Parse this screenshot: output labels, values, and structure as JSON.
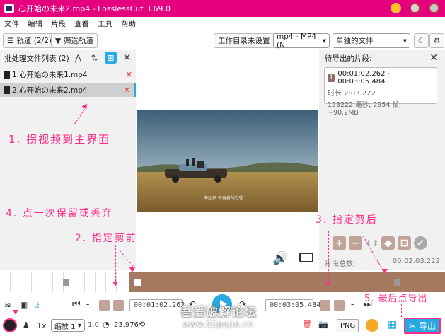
{
  "window": {
    "title": "心开始の未来2.mp4 - LosslessCut 3.69.0"
  },
  "menu": [
    "文件",
    "编辑",
    "片段",
    "查看",
    "工具",
    "帮助"
  ],
  "toolbar": {
    "tracks": "轨道 (2/2)",
    "filter_tracks": "筛选轨道",
    "workdir": "工作目录未设置",
    "format": "mp4 - MP4 (N",
    "output_mode": "单独的文件"
  },
  "file_list": {
    "header": "批处理文件列表 (2)",
    "files": [
      {
        "name": "1.心开始の未来1.mp4"
      },
      {
        "name": "2.心开始の未来2.mp4"
      }
    ]
  },
  "video": {
    "subtitle": "申起杯 每吉春的过往"
  },
  "segments": {
    "header": "待导出的片段:",
    "items": [
      {
        "num": "1",
        "range": "00:01:02.262 - 00:03:05.484",
        "duration": "时长 2:03.222",
        "info": "123222 毫秒, 2954 帧, ~90.2MB"
      }
    ],
    "total_label": "片段总数:",
    "total_time": "00:02:03.222"
  },
  "controls": {
    "start_time": "00:01:02.262",
    "end_time": "00:03:05.484"
  },
  "bottom": {
    "speed": "1x",
    "zoom": "缩放 1",
    "zoom_value": "1.0",
    "fps": "23.976",
    "png": "PNG",
    "export": "导出"
  },
  "annotations": {
    "a1": "1. 拐视频到主界面",
    "a2": "2. 指定剪前",
    "a3": "3. 指定剪后",
    "a4": "4. 点一次保留或丢弃",
    "a5": "5. 最后点导出"
  },
  "watermark": {
    "text": "吾爱破解论坛",
    "url": "www.52pojie.cn"
  },
  "colors": {
    "accent": "#27a9e1",
    "titlebar": "#e5007e",
    "segment": "#a5795f",
    "annotation": "#ff2d8a"
  }
}
